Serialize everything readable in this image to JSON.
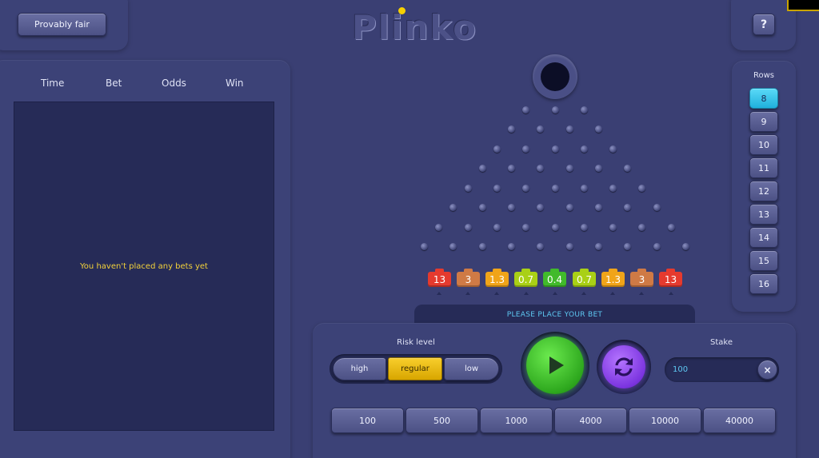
{
  "header": {
    "provably_fair_label": "Provably fair",
    "logo_text": "Plinko",
    "help_label": "?"
  },
  "history": {
    "columns": [
      "Time",
      "Bet",
      "Odds",
      "Win"
    ],
    "empty_message": "You haven't placed any bets yet"
  },
  "board": {
    "multipliers": [
      "13",
      "3",
      "1.3",
      "0.7",
      "0.4",
      "0.7",
      "1.3",
      "3",
      "13"
    ],
    "multiplier_colors": [
      "#e53a2e",
      "#cf7a45",
      "#f0a419",
      "#a9d016",
      "#41ba2b",
      "#a9d016",
      "#f0a419",
      "#cf7a45",
      "#e53a2e"
    ],
    "status": "PLEASE PLACE YOUR BET"
  },
  "rows": {
    "label": "Rows",
    "options": [
      "8",
      "9",
      "10",
      "11",
      "12",
      "13",
      "14",
      "15",
      "16"
    ],
    "selected": "8"
  },
  "controls": {
    "risk_label": "Risk level",
    "risk_options": [
      "high",
      "regular",
      "low"
    ],
    "risk_selected": "regular",
    "stake_label": "Stake",
    "stake_value": "100",
    "clear_label": "×",
    "quick_amounts": [
      "100",
      "500",
      "1000",
      "4000",
      "10000",
      "40000"
    ]
  },
  "colors": {
    "accent_cyan": "#5ec8f2",
    "accent_yellow": "#f8ce2c",
    "play_green": "#2ea81e",
    "refresh_purple": "#7c35e0"
  }
}
